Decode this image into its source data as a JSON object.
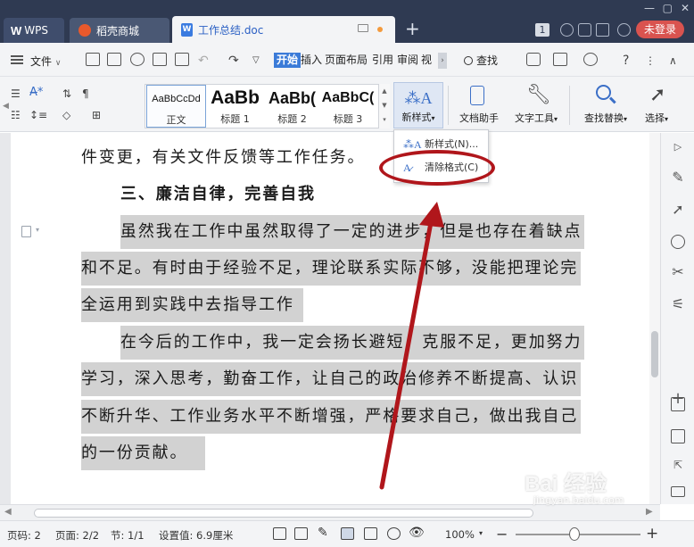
{
  "titlebar": {
    "wps_tab": "WPS",
    "shop_tab": "稻壳商城",
    "doc_tab": "工作总结.doc",
    "doc_icon": "W",
    "badge": "1",
    "login": "未登录"
  },
  "menubar": {
    "file": "文件",
    "tabs": [
      "开始",
      "插入",
      "页面布局",
      "引用",
      "审阅",
      "视"
    ],
    "more": "›",
    "search": "查找"
  },
  "ribbon": {
    "styles": [
      {
        "sample": "AaBbCcDd",
        "name": "正文"
      },
      {
        "sample": "AaBb",
        "name": "标题 1"
      },
      {
        "sample": "AaBb(",
        "name": "标题 2"
      },
      {
        "sample": "AaBbC(",
        "name": "标题 3"
      }
    ],
    "new_style": "新样式",
    "doc_helper": "文档助手",
    "text_tool": "文字工具",
    "find_replace": "查找替换",
    "select": "选择"
  },
  "dropdown": {
    "items": [
      "新样式(N)...",
      "清除格式(C)"
    ]
  },
  "document": {
    "lines": [
      "件变更，有关文件反馈等工作任务。",
      "三、廉洁自律，完善自我",
      "虽然我在工作中虽然取得了一定的进步，但是也存在着缺点",
      "和不足。有时由于经验不足，理论联系实际不够，没能把理论完",
      "全运用到实践中去指导工作",
      "在今后的工作中，我一定会扬长避短，克服不足，更加努力",
      "学习，深入思考，勤奋工作，让自己的政治修养不断提高、认识",
      "不断升华、工作业务水平不断增强，严格要求自己，做出我自己",
      "的一份贡献。"
    ]
  },
  "statusbar": {
    "page_num": "页码: 2",
    "pages": "页面: 2/2",
    "section": "节: 1/1",
    "setting": "设置值: 6.9厘米",
    "zoom": "100%",
    "zoom_level": 100
  },
  "watermark": {
    "brand": "Bai 经验",
    "url": "jingyan.baidu.com"
  }
}
